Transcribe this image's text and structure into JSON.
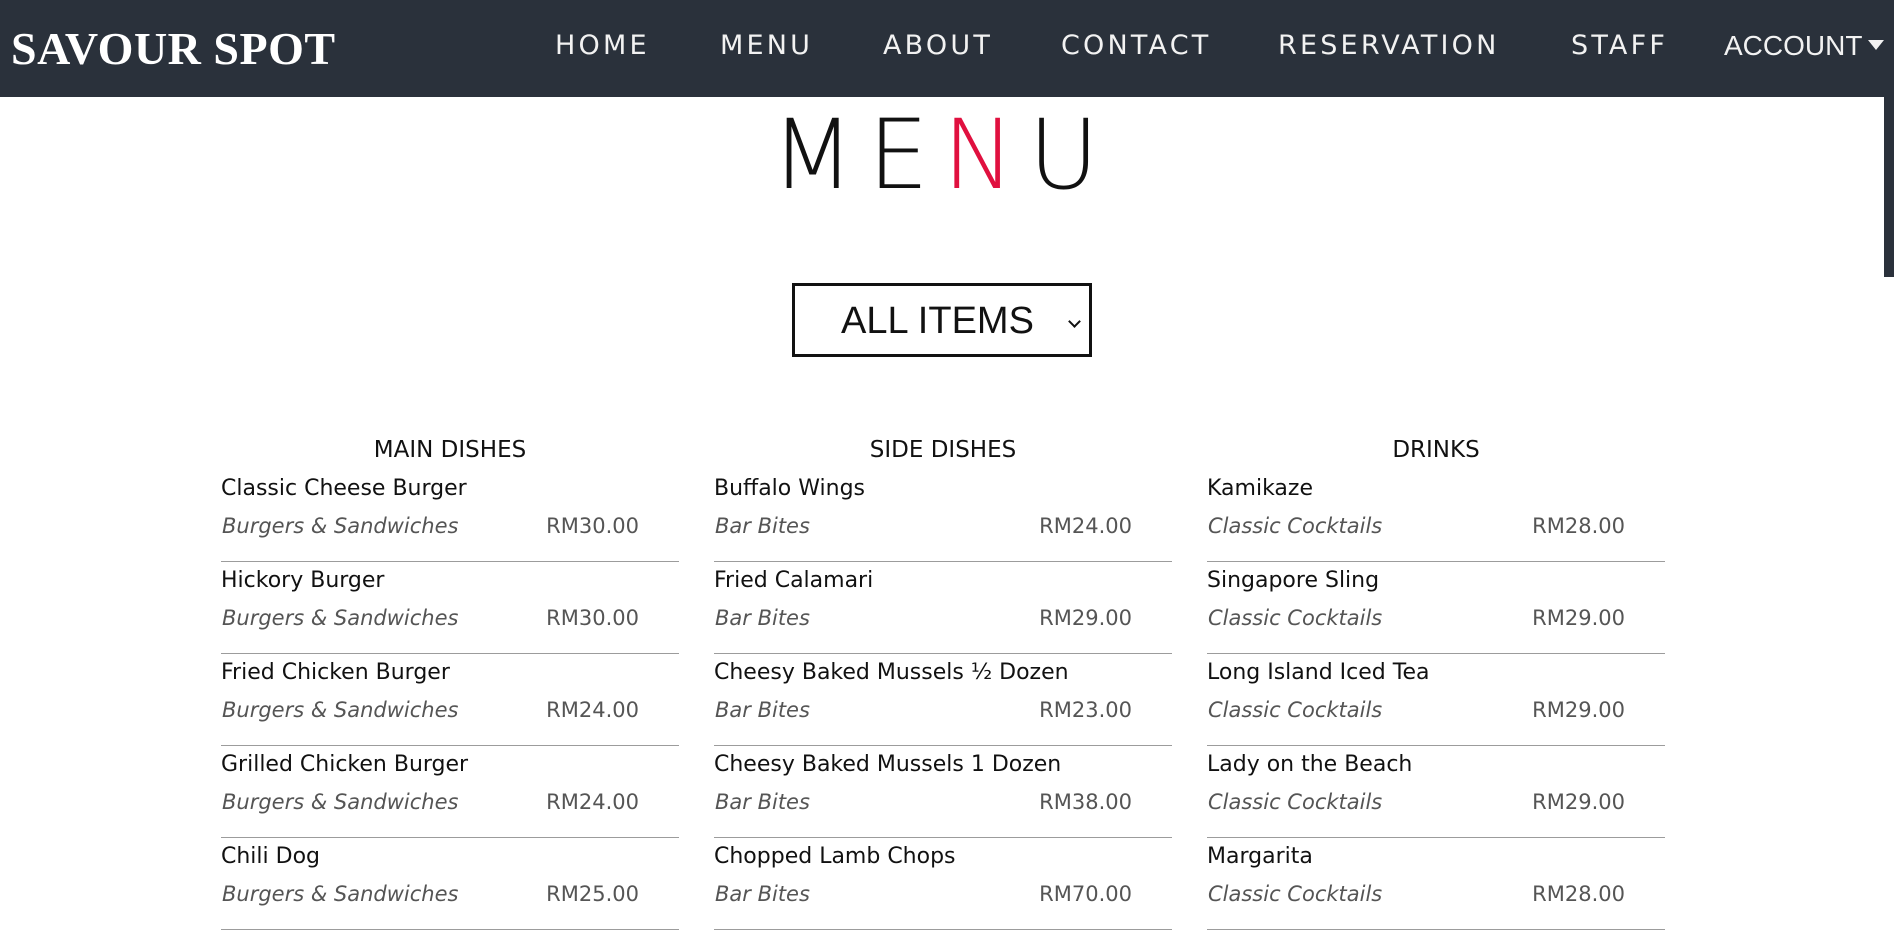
{
  "brand": "SAVOUR SPOT",
  "nav": {
    "home": "HOME",
    "menu": "MENU",
    "about": "ABOUT",
    "contact": "CONTACT",
    "reservation": "RESERVATION",
    "staff": "STAFF",
    "account": "ACCOUNT"
  },
  "title": {
    "part1": "ME",
    "accent": "N",
    "part2": "U"
  },
  "colors": {
    "nav_bg": "#2a313b",
    "accent": "#e0103f"
  },
  "filter": {
    "selected": "ALL ITEMS",
    "icon": "chevron-down-icon"
  },
  "columns": [
    {
      "heading": "MAIN DISHES",
      "items": [
        {
          "name": "Classic Cheese Burger",
          "category": "Burgers & Sandwiches",
          "price": "RM30.00"
        },
        {
          "name": "Hickory Burger",
          "category": "Burgers & Sandwiches",
          "price": "RM30.00"
        },
        {
          "name": "Fried Chicken Burger",
          "category": "Burgers & Sandwiches",
          "price": "RM24.00"
        },
        {
          "name": "Grilled Chicken Burger",
          "category": "Burgers & Sandwiches",
          "price": "RM24.00"
        },
        {
          "name": "Chili Dog",
          "category": "Burgers & Sandwiches",
          "price": "RM25.00"
        }
      ]
    },
    {
      "heading": "SIDE DISHES",
      "items": [
        {
          "name": "Buffalo Wings",
          "category": "Bar Bites",
          "price": "RM24.00"
        },
        {
          "name": "Fried Calamari",
          "category": "Bar Bites",
          "price": "RM29.00"
        },
        {
          "name": "Cheesy Baked Mussels ½ Dozen",
          "category": "Bar Bites",
          "price": "RM23.00"
        },
        {
          "name": "Cheesy Baked Mussels 1 Dozen",
          "category": "Bar Bites",
          "price": "RM38.00"
        },
        {
          "name": "Chopped Lamb Chops",
          "category": "Bar Bites",
          "price": "RM70.00"
        }
      ]
    },
    {
      "heading": "DRINKS",
      "items": [
        {
          "name": "Kamikaze",
          "category": "Classic Cocktails",
          "price": "RM28.00"
        },
        {
          "name": "Singapore Sling",
          "category": "Classic Cocktails",
          "price": "RM29.00"
        },
        {
          "name": "Long Island Iced Tea",
          "category": "Classic Cocktails",
          "price": "RM29.00"
        },
        {
          "name": "Lady on the Beach",
          "category": "Classic Cocktails",
          "price": "RM29.00"
        },
        {
          "name": "Margarita",
          "category": "Classic Cocktails",
          "price": "RM28.00"
        }
      ]
    }
  ]
}
